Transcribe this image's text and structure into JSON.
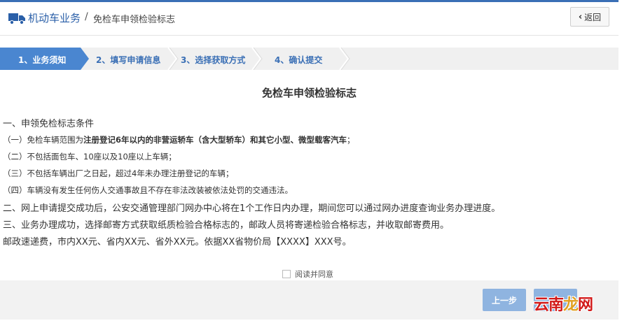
{
  "header": {
    "title": "机动车业务",
    "separator": "/",
    "subtitle": "免检车申领检验标志",
    "back_label": "返回"
  },
  "steps": [
    {
      "label": "1、业务须知",
      "state": "active"
    },
    {
      "label": "2、填写申请信息",
      "state": "todo"
    },
    {
      "label": "3、选择获取方式",
      "state": "todo"
    },
    {
      "label": "4、确认提交",
      "state": "todo"
    }
  ],
  "doc": {
    "title": "免检车申领检验标志",
    "section1": "一、申领免检标志条件",
    "item1_prefix": "（一）免检车辆范围为",
    "item1_bold": "注册登记6年以内的非营运轿车（含大型轿车）和其它小型、微型载客汽车",
    "item1_suffix": "；",
    "item2": "（二）不包括面包车、10座以及10座以上车辆；",
    "item3": "（三）不包括车辆出厂之日起，超过4年未办理注册登记的车辆；",
    "item4": "（四）车辆没有发生任何伤人交通事故且不存在非法改装被依法处罚的交通违法。",
    "section2": "二、网上申请提交成功后，公安交通管理部门网办中心将在1个工作日内办理，期间您可以通过网办进度查询业务办理进度。",
    "section3": "三、业务办理成功，选择邮寄方式获取纸质检验合格标志的，邮政人员将寄递检验合格标志，并收取邮寄费用。",
    "fee": "邮政速递费，市内XX元、省内XX元、省外XX元。依据XX省物价局【XXXX】XXX号。"
  },
  "agree_label": "阅读并同意",
  "footer": {
    "prev_label": "上一步",
    "next_label": ""
  },
  "watermark": {
    "part1": "云南",
    "part2": "龙",
    "part3": "网"
  },
  "colors": {
    "accent": "#3a6fb5",
    "active_step": "#4a86d0",
    "button": "#8fb4e0"
  }
}
